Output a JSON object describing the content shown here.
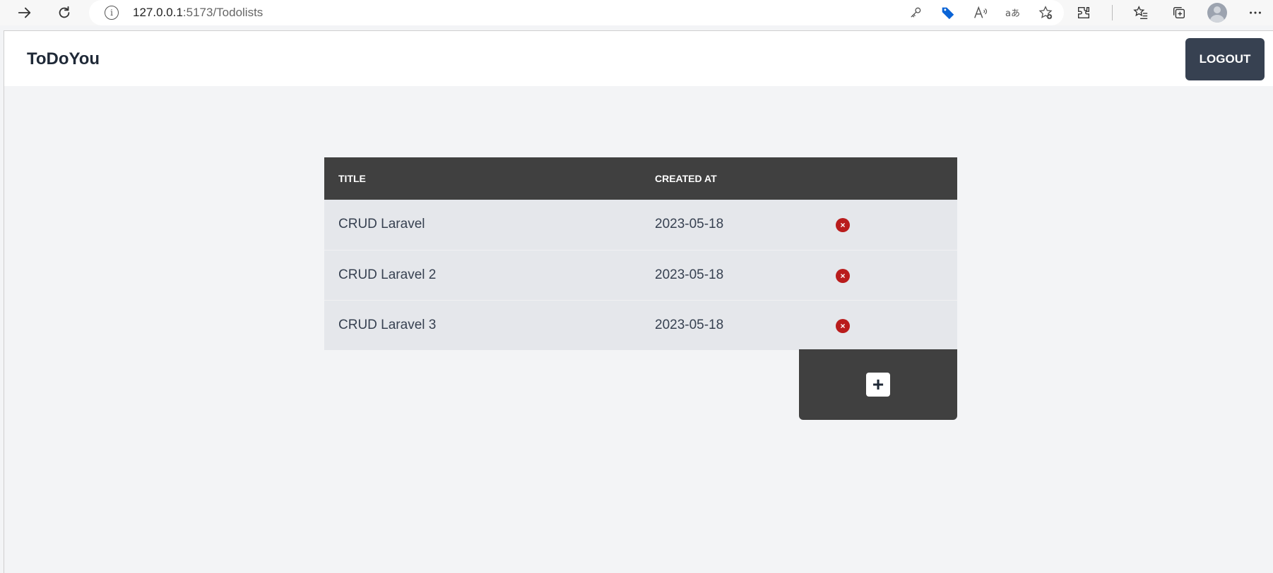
{
  "browser": {
    "url_host": "127.0.0.1",
    "url_path": ":5173/Todolists",
    "info_icon": "i"
  },
  "app": {
    "brand": "ToDoYou",
    "logout_label": "LOGOUT"
  },
  "table": {
    "headers": [
      "TITLE",
      "CREATED AT",
      ""
    ],
    "rows": [
      {
        "title": "CRUD Laravel",
        "created_at": "2023-05-18"
      },
      {
        "title": "CRUD Laravel 2",
        "created_at": "2023-05-18"
      },
      {
        "title": "CRUD Laravel 3",
        "created_at": "2023-05-18"
      }
    ],
    "delete_icon": "×",
    "add_icon": "+"
  },
  "colors": {
    "header_bg": "#404040",
    "row_bg": "#e5e7eb",
    "delete": "#b91c1c",
    "logout_bg": "#374151"
  }
}
